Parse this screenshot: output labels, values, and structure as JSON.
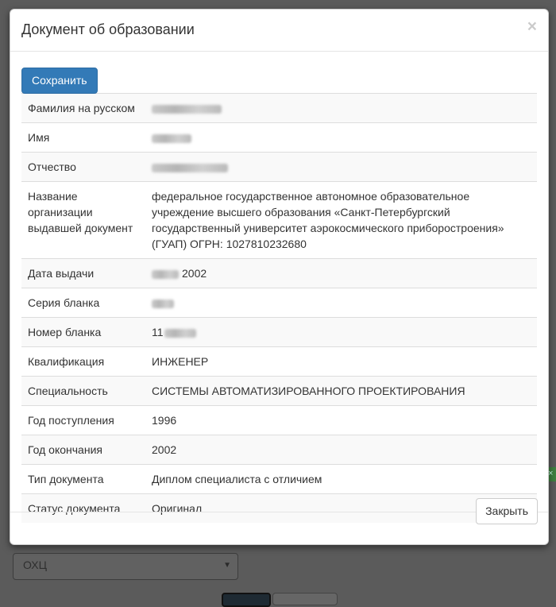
{
  "modal": {
    "title": "Документ об образовании",
    "close_glyph": "×",
    "save_label": "Сохранить",
    "close_label": "Закрыть"
  },
  "fields": [
    {
      "label": "Фамилия на русском",
      "value": "",
      "redacted": true
    },
    {
      "label": "Имя",
      "value": "",
      "redacted": true
    },
    {
      "label": "Отчество",
      "value": "",
      "redacted": true
    },
    {
      "label": "Название организации выдавшей документ",
      "value": "федеральное государственное автономное образовательное учреждение высшего образования «Санкт-Петербургский государственный университет аэрокосмического приборостроения» (ГУАП) ОГРН: 1027810232680"
    },
    {
      "label": "Дата выдачи",
      "value": "2002",
      "redacted_prefix": true
    },
    {
      "label": "Серия бланка",
      "value": "",
      "redacted": true
    },
    {
      "label": "Номер бланка",
      "value": "11",
      "redacted_suffix": true
    },
    {
      "label": "Квалификация",
      "value": "ИНЖЕНЕР"
    },
    {
      "label": "Специальность",
      "value": "СИСТЕМЫ АВТОМАТИЗИРОВАННОГО ПРОЕКТИРОВАНИЯ"
    },
    {
      "label": "Год поступления",
      "value": "1996"
    },
    {
      "label": "Год окончания",
      "value": "2002"
    },
    {
      "label": "Тип документа",
      "value": "Диплом специалиста с отличием"
    },
    {
      "label": "Статус документа",
      "value": "Оригинал"
    }
  ],
  "background": {
    "select_value": "ОХЦ",
    "green_badge_glyph": "×"
  }
}
